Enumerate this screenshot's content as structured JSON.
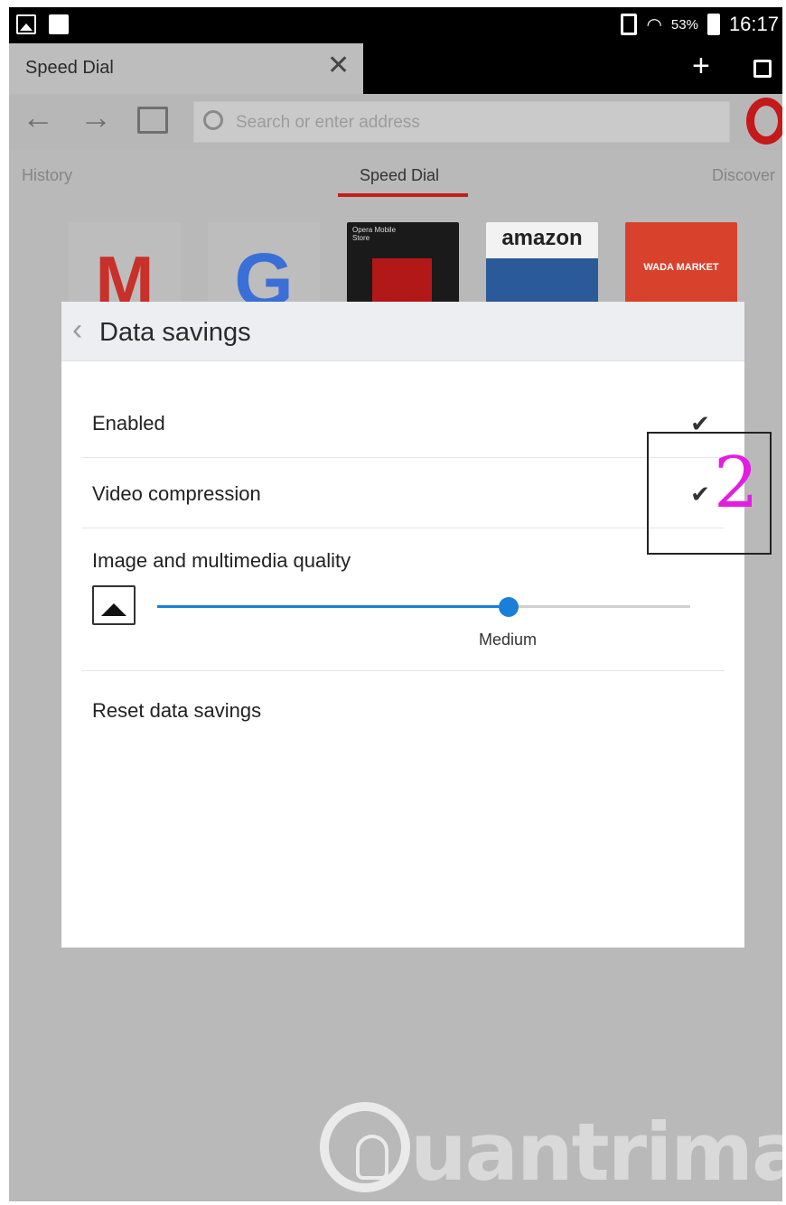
{
  "status_bar": {
    "battery": "53%",
    "time": "16:17"
  },
  "tab": {
    "title": "Speed Dial",
    "close_glyph": "✕",
    "new_tab_glyph": "+"
  },
  "toolbar": {
    "back_glyph": "←",
    "forward_glyph": "→",
    "address_placeholder": "Search or enter address"
  },
  "speed_dial_tabs": [
    "History",
    "Speed Dial",
    "Discover"
  ],
  "tiles": {
    "gmail": "M",
    "google": "G",
    "opera_store": "Opera Mobile Store",
    "amazon": "amazon",
    "wada": "WADA MARKET"
  },
  "dialog": {
    "back_glyph": "‹",
    "title": "Data savings",
    "enabled_label": "Enabled",
    "enabled_checked": true,
    "video_label": "Video compression",
    "video_checked": true,
    "check_glyph": "✔",
    "quality_label": "Image and multimedia quality",
    "quality_value": "Medium",
    "quality_level": 0.66,
    "reset_label": "Reset data savings"
  },
  "annotation": {
    "number": "2"
  },
  "watermark": {
    "text": "uantrimang"
  },
  "colors": {
    "accent": "#1b7fd8",
    "opera_red": "#c41a1a",
    "annotation": "#e21ee2"
  }
}
